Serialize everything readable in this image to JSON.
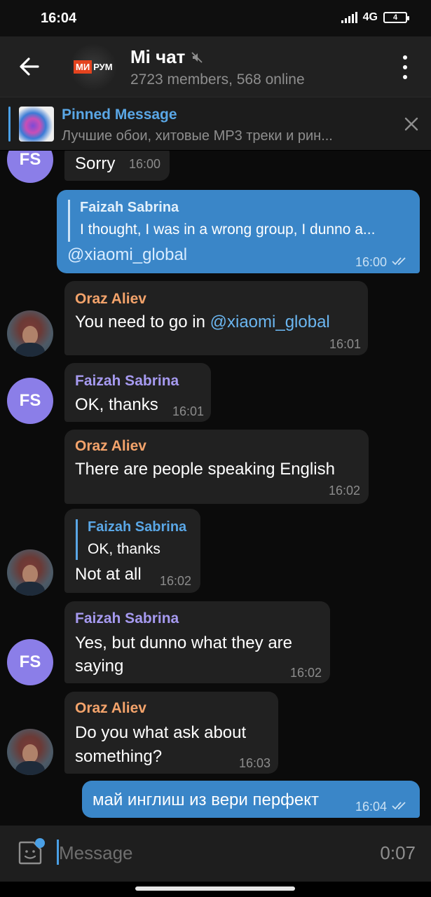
{
  "status_bar": {
    "time": "16:04",
    "network": "4G",
    "battery": "4"
  },
  "header": {
    "title": "Mi чат",
    "subtitle": "2723 members, 568 online",
    "avatar_logo_left": "МИ",
    "avatar_logo_right": "РУМ"
  },
  "pinned": {
    "title": "Pinned Message",
    "text": "Лучшие обои, хитовые MP3 треки и рин..."
  },
  "messages": [
    {
      "text": "Sorry",
      "time": "16:00"
    },
    {
      "reply_name": "Faizah Sabrina",
      "reply_text": "I thought, I was in a wrong group, I dunno a...",
      "text": "@xiaomi_global",
      "time": "16:00"
    },
    {
      "sender": "Oraz Aliev",
      "text_prefix": "You need to go in ",
      "link": "@xiaomi_global",
      "time": "16:01"
    },
    {
      "sender": "Faizah Sabrina",
      "text": "OK, thanks",
      "time": "16:01"
    },
    {
      "sender": "Oraz Aliev",
      "text": "There are people speaking English",
      "time": "16:02"
    },
    {
      "reply_name": "Faizah Sabrina",
      "reply_text": "OK, thanks",
      "text": "Not at all",
      "time": "16:02"
    },
    {
      "sender": "Faizah Sabrina",
      "text_line1": "Yes, but dunno what they are",
      "text_line2": "saying",
      "time": "16:02"
    },
    {
      "sender": "Oraz Aliev",
      "text_line1": "Do you what ask about",
      "text_line2": "something?",
      "time": "16:03"
    },
    {
      "text": "май инглиш из вери перфект",
      "time": "16:04"
    }
  ],
  "avatars": {
    "fs_initials": "FS"
  },
  "input": {
    "placeholder": "Message",
    "record_time": "0:07"
  },
  "colors": {
    "accent": "#4aa0e6",
    "outgoing_bubble": "#3a86c8",
    "incoming_bubble": "#212121",
    "sender_orange": "#f3a36b",
    "sender_purple": "#a69af0"
  }
}
